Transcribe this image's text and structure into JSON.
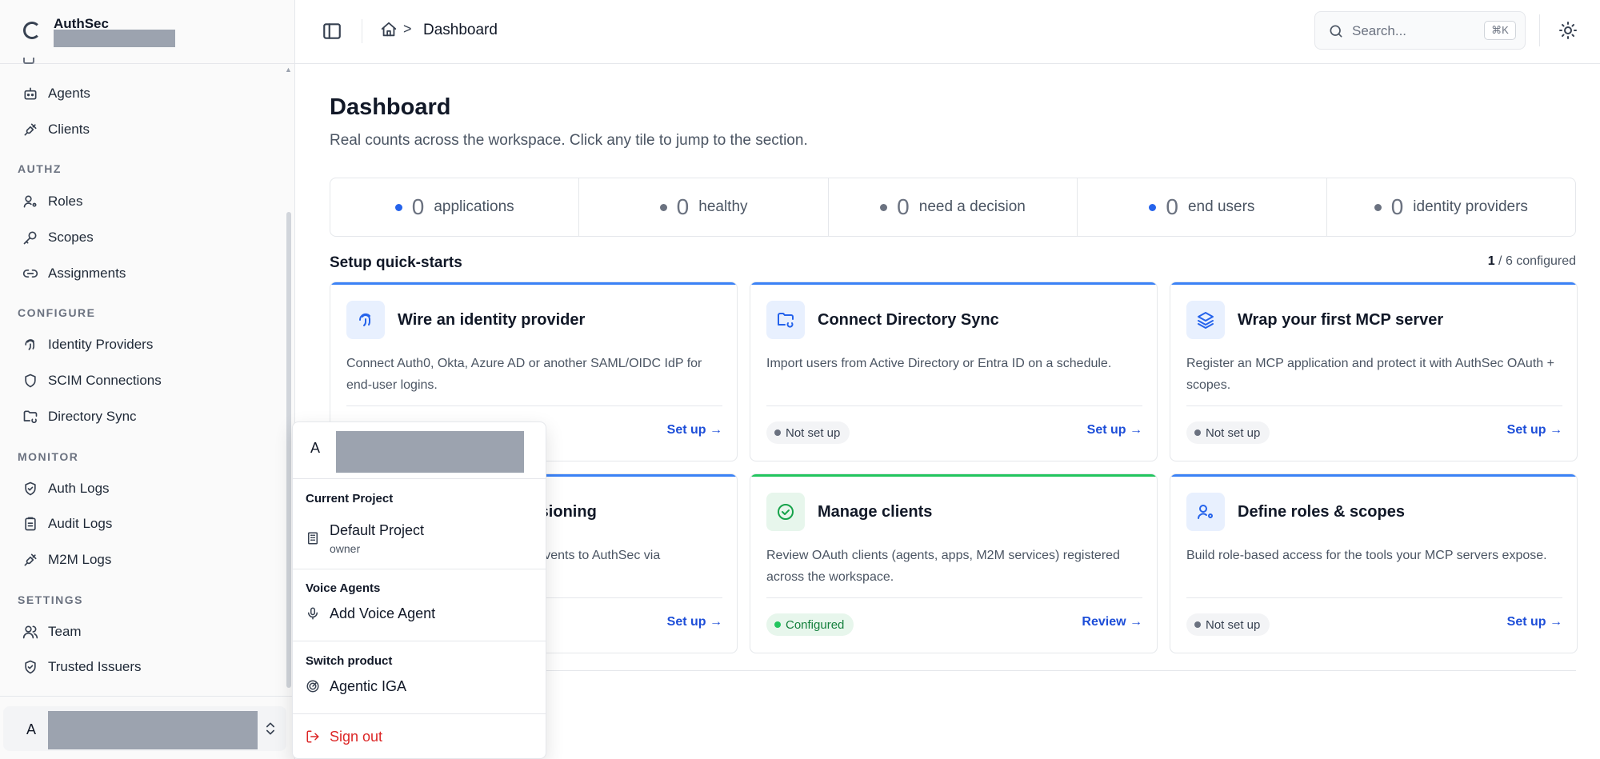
{
  "brand": {
    "name": "AuthSec"
  },
  "sidebar": {
    "items": [
      {
        "label": "Agents",
        "icon": "bot-icon"
      },
      {
        "label": "Clients",
        "icon": "plug-icon"
      }
    ],
    "sections": [
      {
        "title": "AUTHZ",
        "items": [
          {
            "label": "Roles",
            "icon": "user-key-icon"
          },
          {
            "label": "Scopes",
            "icon": "key-icon"
          },
          {
            "label": "Assignments",
            "icon": "link-icon"
          }
        ]
      },
      {
        "title": "CONFIGURE",
        "items": [
          {
            "label": "Identity Providers",
            "icon": "fingerprint-icon"
          },
          {
            "label": "SCIM Connections",
            "icon": "shield-icon"
          },
          {
            "label": "Directory Sync",
            "icon": "folder-sync-icon"
          }
        ]
      },
      {
        "title": "MONITOR",
        "items": [
          {
            "label": "Auth Logs",
            "icon": "shield-check-icon"
          },
          {
            "label": "Audit Logs",
            "icon": "clipboard-icon"
          },
          {
            "label": "M2M Logs",
            "icon": "plug-icon"
          }
        ]
      },
      {
        "title": "SETTINGS",
        "items": [
          {
            "label": "Team",
            "icon": "users-icon"
          },
          {
            "label": "Trusted Issuers",
            "icon": "shield-check-icon"
          }
        ]
      }
    ],
    "user_initial": "A"
  },
  "header": {
    "breadcrumb_current": "Dashboard",
    "breadcrumb_separator": ">",
    "search_placeholder": "Search...",
    "search_shortcut": "⌘K"
  },
  "main": {
    "title": "Dashboard",
    "subtitle": "Real counts across the workspace. Click any tile to jump to the section.",
    "stats": [
      {
        "value": "0",
        "label": "applications",
        "dot_color": "#2563eb"
      },
      {
        "value": "0",
        "label": "healthy",
        "dot_color": "#6b7280"
      },
      {
        "value": "0",
        "label": "need a decision",
        "dot_color": "#6b7280"
      },
      {
        "value": "0",
        "label": "end users",
        "dot_color": "#2563eb"
      },
      {
        "value": "0",
        "label": "identity providers",
        "dot_color": "#6b7280"
      }
    ],
    "quickstarts_title": "Setup quick-starts",
    "quickstarts_count": "1",
    "quickstarts_count_suffix": "/ 6 configured",
    "cards": [
      {
        "title": "Wire an identity provider",
        "desc": "Connect Auth0, Okta, Azure AD or another SAML/OIDC IdP for end-user logins.",
        "status": "",
        "action": "Set up →",
        "icon": "fingerprint-icon"
      },
      {
        "title": "Connect Directory Sync",
        "desc": "Import users from Active Directory or Entra ID on a schedule.",
        "status": "Not set up",
        "action": "Set up →",
        "icon": "folder-sync-icon"
      },
      {
        "title": "Wrap your first MCP server",
        "desc": "Register an MCP application and protect it with AuthSec OAuth + scopes.",
        "status": "Not set up",
        "action": "Set up →",
        "icon": "layers-icon"
      },
      {
        "title": "visioning",
        "desc": "g events to AuthSec via",
        "status": "",
        "action": "Set up →",
        "icon": ""
      },
      {
        "title": "Manage clients",
        "desc": "Review OAuth clients (agents, apps, M2M services) registered across the workspace.",
        "status": "Configured",
        "action": "Review →",
        "icon": "check-circle-icon"
      },
      {
        "title": "Define roles & scopes",
        "desc": "Build role-based access for the tools your MCP servers expose.",
        "status": "Not set up",
        "action": "Set up →",
        "icon": "user-key-icon"
      }
    ]
  },
  "dropdown": {
    "avatar_initial": "A",
    "current_project_label": "Current Project",
    "project_name": "Default Project",
    "project_role": "owner",
    "voice_agents_label": "Voice Agents",
    "add_voice_agent": "Add Voice Agent",
    "switch_product_label": "Switch product",
    "agentic_iga": "Agentic IGA",
    "sign_out": "Sign out"
  }
}
